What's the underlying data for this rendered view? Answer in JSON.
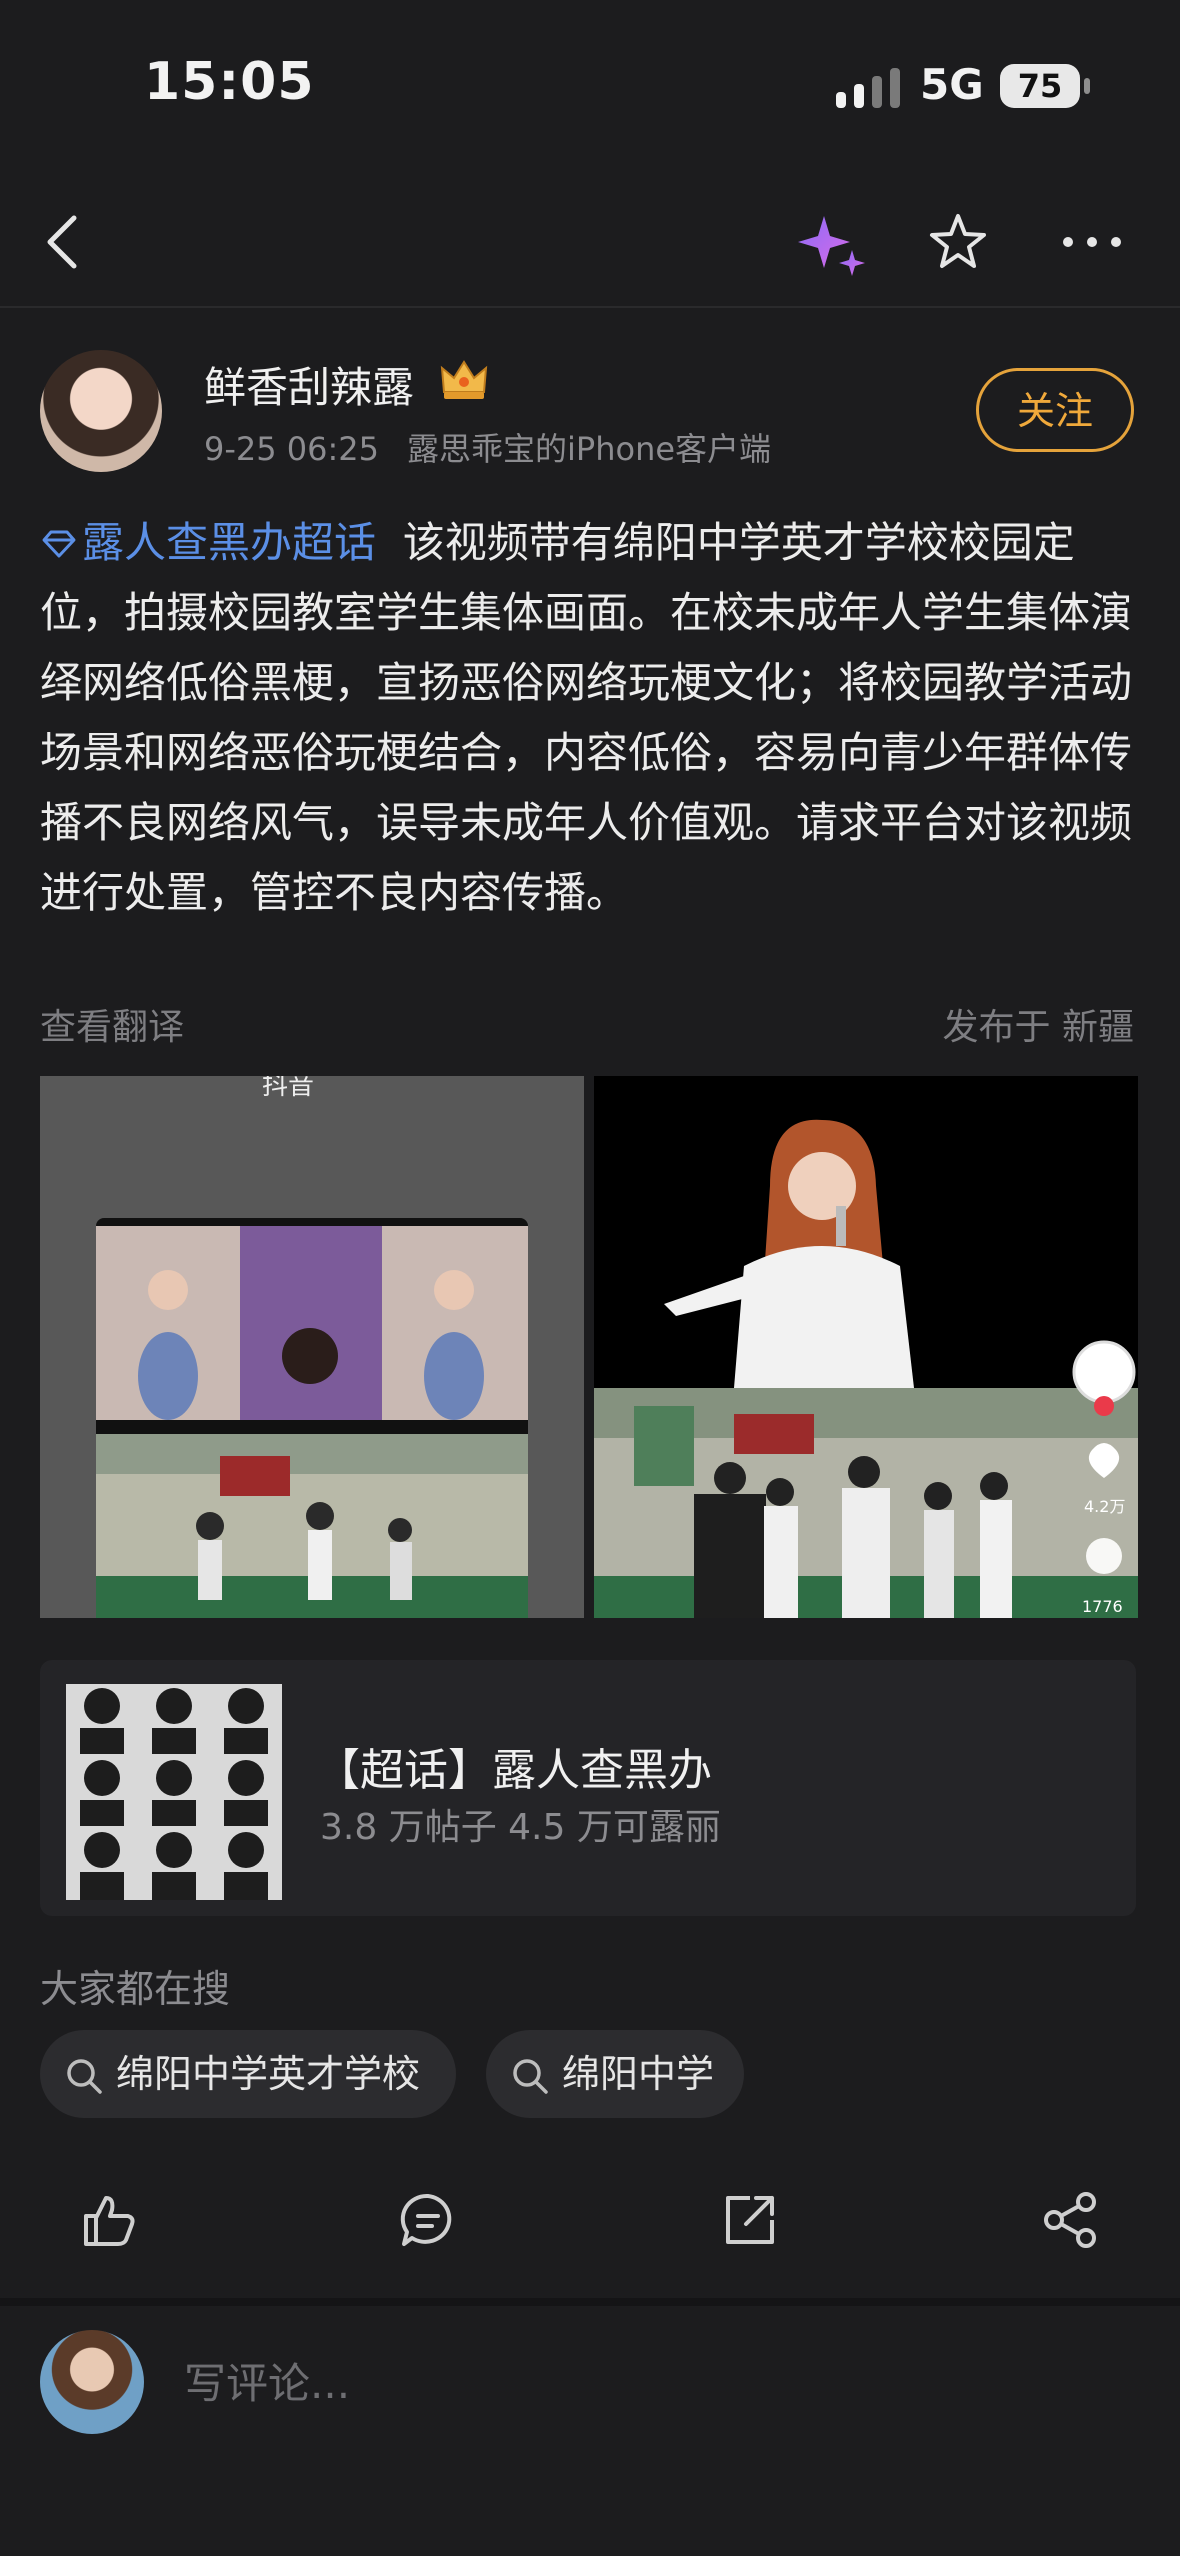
{
  "status_bar": {
    "time": "15:05",
    "network": "5G",
    "battery": "75"
  },
  "post": {
    "author": "鲜香刮辣露",
    "date": "9-25 06:25",
    "client": "露思乖宝的iPhone客户端",
    "follow_label": "关注",
    "topic": "露人查黑办超话",
    "body": "该视频带有绵阳中学英才学校校园定位，拍摄校园教室学生集体画面。在校未成年人学生集体演绎网络低俗黑梗，宣扬恶俗网络玩梗文化；将校园教学活动场景和网络恶俗玩梗结合，内容低俗，容易向青少年群体传播不良网络风气，误导未成年人价值观。请求平台对该视频进行处置，管控不良内容传播。",
    "translate_label": "查看翻译",
    "location": "发布于 新疆"
  },
  "images": {
    "left_watermark": "抖音",
    "right_like_count": "4.2万",
    "right_comment_count": "1776"
  },
  "supertopic_card": {
    "title": "【超话】露人查黑办",
    "stats": "3.8 万帖子 4.5 万可露丽"
  },
  "search": {
    "heading": "大家都在搜",
    "chips": [
      "绵阳中学英才学校",
      "绵阳中学"
    ]
  },
  "actions": [
    "like-icon",
    "comment-icon",
    "repost-icon",
    "share-icon"
  ],
  "comment_placeholder": "写评论...",
  "colors": {
    "accent": "#e5a33b",
    "topic": "#5b8fe6",
    "background": "#1c1c1e"
  }
}
